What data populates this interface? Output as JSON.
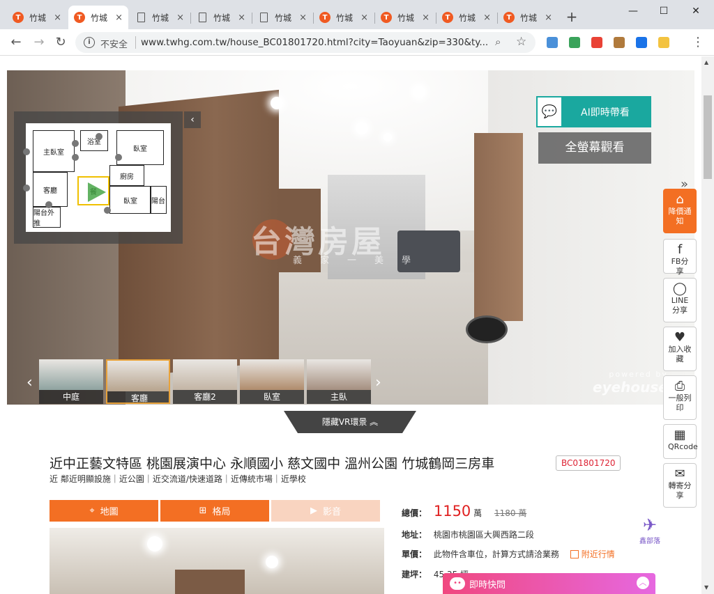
{
  "browser": {
    "tabs": [
      {
        "title": "竹城",
        "icon": "twhg"
      },
      {
        "title": "竹城",
        "icon": "twhg",
        "active": true
      },
      {
        "title": "竹城",
        "icon": "doc"
      },
      {
        "title": "竹城",
        "icon": "doc"
      },
      {
        "title": "竹城",
        "icon": "doc"
      },
      {
        "title": "竹城",
        "icon": "twhg"
      },
      {
        "title": "竹城",
        "icon": "twhg"
      },
      {
        "title": "竹城",
        "icon": "twhg"
      },
      {
        "title": "竹城",
        "icon": "twhg"
      }
    ],
    "tab_close": "×",
    "tab_logo_char": "T",
    "new_tab": "+",
    "win_min": "—",
    "win_max": "☐",
    "win_close": "✕",
    "back": "←",
    "forward": "→",
    "reload": "↻",
    "security": "不安全",
    "url": "www.twhg.com.tw/house_BC01801720.html?city=Taoyuan&zip=330&ty...",
    "info_glyph": "i",
    "zoom_glyph": "⌕",
    "star_glyph": "☆",
    "menu_glyph": "⋮",
    "extension_colors": [
      "#4a90d9",
      "#3aa35b",
      "#e94235",
      "#b07a3c",
      "#1a73e8",
      "#f3c340"
    ]
  },
  "vr": {
    "ai_button": "AI即時帶看",
    "ai_glyph": "💬",
    "fullscreen_button": "全螢幕觀看",
    "collapse_glyph": "‹",
    "more_glyph": "»",
    "watermark": "台灣房屋",
    "watermark_sub": "義家一美學",
    "minimap_rooms": [
      "主臥室",
      "臥室",
      "客廳",
      "廚房",
      "臥室",
      "陽台",
      "陽台外推",
      "浴室",
      "餐"
    ],
    "thumbnails": [
      {
        "label": "中庭",
        "color": "#8fa3a0"
      },
      {
        "label": "客廳",
        "color": "#b7a48e",
        "active": true
      },
      {
        "label": "客廳2",
        "color": "#c3b5a5"
      },
      {
        "label": "臥室",
        "color": "#b08c6c"
      },
      {
        "label": "主臥",
        "color": "#a58f80"
      }
    ],
    "prev_glyph": "‹",
    "next_glyph": "›",
    "powered_by": "powered by",
    "powered_brand": "eyehouse",
    "hide_vr": "隱藏VR環景 ︽"
  },
  "side_rail": [
    {
      "label": "降價通知",
      "glyph": "⌂",
      "hot": true
    },
    {
      "label": "FB分享",
      "glyph": "f"
    },
    {
      "label": "LINE分享",
      "glyph": "◯"
    },
    {
      "label": "加入收藏",
      "glyph": "♥"
    },
    {
      "label": "一般列印",
      "glyph": "⎙"
    },
    {
      "label": "QRcode",
      "glyph": "▦"
    },
    {
      "label": "轉寄分享",
      "glyph": "✉"
    }
  ],
  "listing": {
    "title": "近中正藝文特區 桃園展演中心 永順國小 慈文國中 溫州公園 竹城鶴岡三房車",
    "code": "BC01801720",
    "tags": "近 鄰近明顯設施｜近公園｜近交流道/快速道路｜近傳統市場｜近學校",
    "buttons": [
      {
        "label": "地圖",
        "glyph": "⌖"
      },
      {
        "label": "格局",
        "glyph": "⊞"
      },
      {
        "label": "影音",
        "glyph": "▶",
        "dim": true
      }
    ],
    "total_label": "總價：",
    "price": "1150",
    "price_unit": "萬",
    "old_price": "1180 萬",
    "address_label": "地址：",
    "address": "桃園市桃園區大興西路二段",
    "unit_label": "單價：",
    "unit_text": "此物件含車位，計算方式請洽業務",
    "nearby": "附近行情",
    "area_label": "建坪：",
    "area_value": "45.35 坪"
  },
  "chat": {
    "label": "即時快問",
    "glyph": "••",
    "up_glyph": "︿"
  },
  "brand_badge": {
    "glyph": "✈",
    "text": "鑫部落"
  }
}
